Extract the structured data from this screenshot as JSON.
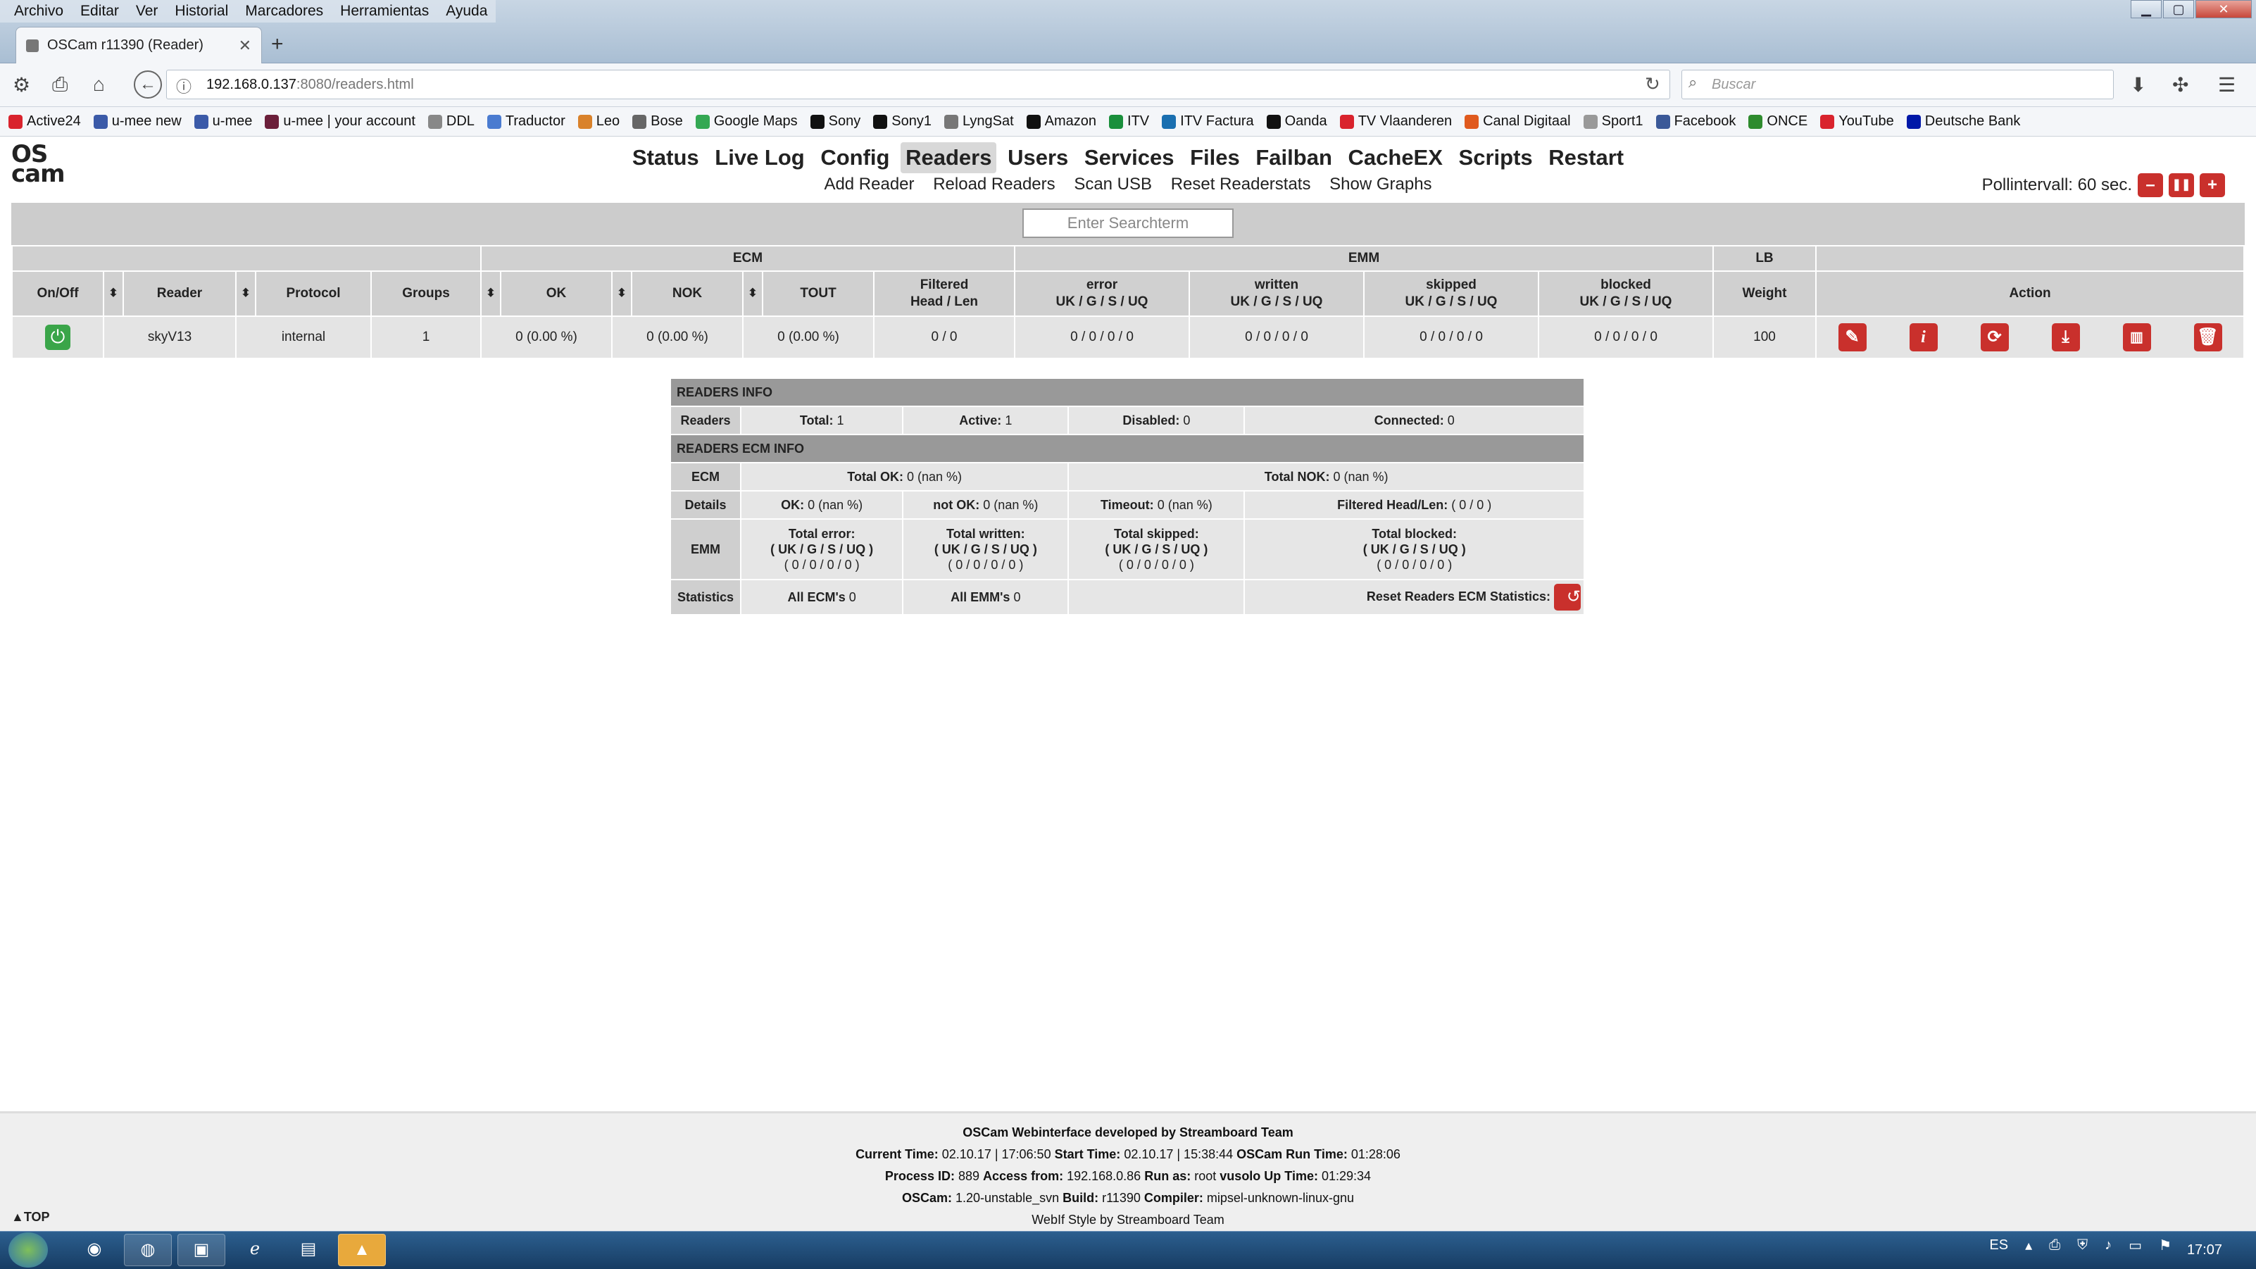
{
  "window": {
    "menu": [
      "Archivo",
      "Editar",
      "Ver",
      "Historial",
      "Marcadores",
      "Herramientas",
      "Ayuda"
    ],
    "tab_title": "OSCam r11390 (Reader)",
    "url_host": "192.168.0.137",
    "url_rest": ":8080/readers.html",
    "search_placeholder": "Buscar"
  },
  "bookmarks": [
    {
      "label": "Active24",
      "color": "#d9232d"
    },
    {
      "label": "u-mee new",
      "color": "#3b5aa8"
    },
    {
      "label": "u-mee",
      "color": "#3b5aa8"
    },
    {
      "label": "u-mee | your account",
      "color": "#6b1f3a"
    },
    {
      "label": "DDL",
      "color": "#888888"
    },
    {
      "label": "Traductor",
      "color": "#4a7bd0"
    },
    {
      "label": "Leo",
      "color": "#d9822b"
    },
    {
      "label": "Bose",
      "color": "#666666"
    },
    {
      "label": "Google Maps",
      "color": "#34a853"
    },
    {
      "label": "Sony",
      "color": "#111111"
    },
    {
      "label": "Sony1",
      "color": "#111111"
    },
    {
      "label": "LyngSat",
      "color": "#777777"
    },
    {
      "label": "Amazon",
      "color": "#111111"
    },
    {
      "label": "ITV",
      "color": "#1a8f3c"
    },
    {
      "label": "ITV Factura",
      "color": "#1a6fb0"
    },
    {
      "label": "Oanda",
      "color": "#111111"
    },
    {
      "label": "TV Vlaanderen",
      "color": "#d9232d"
    },
    {
      "label": "Canal Digitaal",
      "color": "#e05a1e"
    },
    {
      "label": "Sport1",
      "color": "#999999"
    },
    {
      "label": "Facebook",
      "color": "#3b5998"
    },
    {
      "label": "ONCE",
      "color": "#2e8b2e"
    },
    {
      "label": "YouTube",
      "color": "#d9232d"
    },
    {
      "label": "Deutsche Bank",
      "color": "#0018a8"
    }
  ],
  "oscam": {
    "logo_top": "OS",
    "logo_bottom": "cam",
    "menu": [
      "Status",
      "Live Log",
      "Config",
      "Readers",
      "Users",
      "Services",
      "Files",
      "Failban",
      "CacheEX",
      "Scripts",
      "Restart"
    ],
    "active_menu": "Readers",
    "submenu": [
      "Add Reader",
      "Reload Readers",
      "Scan USB",
      "Reset Readerstats",
      "Show Graphs"
    ],
    "poll_label": "Pollintervall: 60 sec.",
    "poll_minus": "–",
    "poll_pause": "❚❚",
    "poll_plus": "+",
    "search_placeholder": "Enter Searchterm",
    "accent": "#c9302c",
    "enabled_color": "#3aa549"
  },
  "readers_table": {
    "group_headers": {
      "ecm": "ECM",
      "emm": "EMM",
      "lb": "LB"
    },
    "headers": {
      "onoff": "On/Off",
      "reader": "Reader",
      "protocol": "Protocol",
      "groups": "Groups",
      "ok": "OK",
      "nok": "NOK",
      "tout": "TOUT",
      "filtered_1": "Filtered",
      "filtered_2": "Head / Len",
      "error_1": "error",
      "written_1": "written",
      "skipped_1": "skipped",
      "blocked_1": "blocked",
      "emm_sub": "UK / G / S / UQ",
      "weight": "Weight",
      "action": "Action"
    },
    "row": {
      "reader": "skyV13",
      "protocol": "internal",
      "groups": "1",
      "ok": "0 (0.00 %)",
      "nok": "0 (0.00 %)",
      "tout": "0 (0.00 %)",
      "filtered": "0 / 0",
      "error": "0 / 0 / 0 / 0",
      "written": "0 / 0 / 0 / 0",
      "skipped": "0 / 0 / 0 / 0",
      "blocked": "0 / 0 / 0 / 0",
      "weight": "100"
    },
    "actions": [
      "edit-icon",
      "info-icon",
      "refresh-icon",
      "download-icon",
      "graph-icon",
      "delete-icon"
    ]
  },
  "readers_info": {
    "title": "READERS INFO",
    "readers_label": "Readers",
    "total_label": "Total:",
    "total": "1",
    "active_label": "Active:",
    "active": "1",
    "disabled_label": "Disabled:",
    "disabled": "0",
    "connected_label": "Connected:",
    "connected": "0",
    "ecm_title": "READERS ECM INFO",
    "ecm_label": "ECM",
    "total_ok_label": "Total OK:",
    "total_ok": "0 (nan %)",
    "total_nok_label": "Total NOK:",
    "total_nok": "0 (nan %)",
    "details_label": "Details",
    "ok_label": "OK:",
    "ok": "0 (nan %)",
    "notok_label": "not OK:",
    "notok": "0 (nan %)",
    "timeout_label": "Timeout:",
    "timeout": "0 (nan %)",
    "filtered_label": "Filtered Head/Len:",
    "filtered": "( 0 / 0 )",
    "emm_label": "EMM",
    "emm_sub": "( UK / G / S / UQ )",
    "emm_vals": "( 0 / 0 / 0 / 0 )",
    "total_error": "Total error:",
    "total_written": "Total written:",
    "total_skipped": "Total skipped:",
    "total_blocked": "Total blocked:",
    "stats_label": "Statistics",
    "all_ecm_label": "All ECM's",
    "all_ecm": "0",
    "all_emm_label": "All EMM's",
    "all_emm": "0",
    "reset_label": "Reset Readers ECM Statistics:"
  },
  "footer": {
    "line1": "OSCam Webinterface developed by Streamboard Team",
    "current_time_label": "Current Time:",
    "current_time": "02.10.17 | 17:06:50",
    "start_time_label": "Start Time:",
    "start_time": "02.10.17 | 15:38:44",
    "run_time_label": "OSCam Run Time:",
    "run_time": "01:28:06",
    "pid_label": "Process ID:",
    "pid": "889",
    "access_label": "Access from:",
    "access": "192.168.0.86",
    "runas_label": "Run as:",
    "runas": "root",
    "box_uptime_label": "vusolo Up Time:",
    "box_uptime": "01:29:34",
    "oscam_label": "OSCam:",
    "oscam": "1.20-unstable_svn",
    "build_label": "Build:",
    "build": "r11390",
    "compiler_label": "Compiler:",
    "compiler": "mipsel-unknown-linux-gnu",
    "webif": "WebIf Style by Streamboard Team",
    "top": "▲TOP"
  },
  "taskbar": {
    "lang": "ES",
    "clock": "17:07"
  }
}
